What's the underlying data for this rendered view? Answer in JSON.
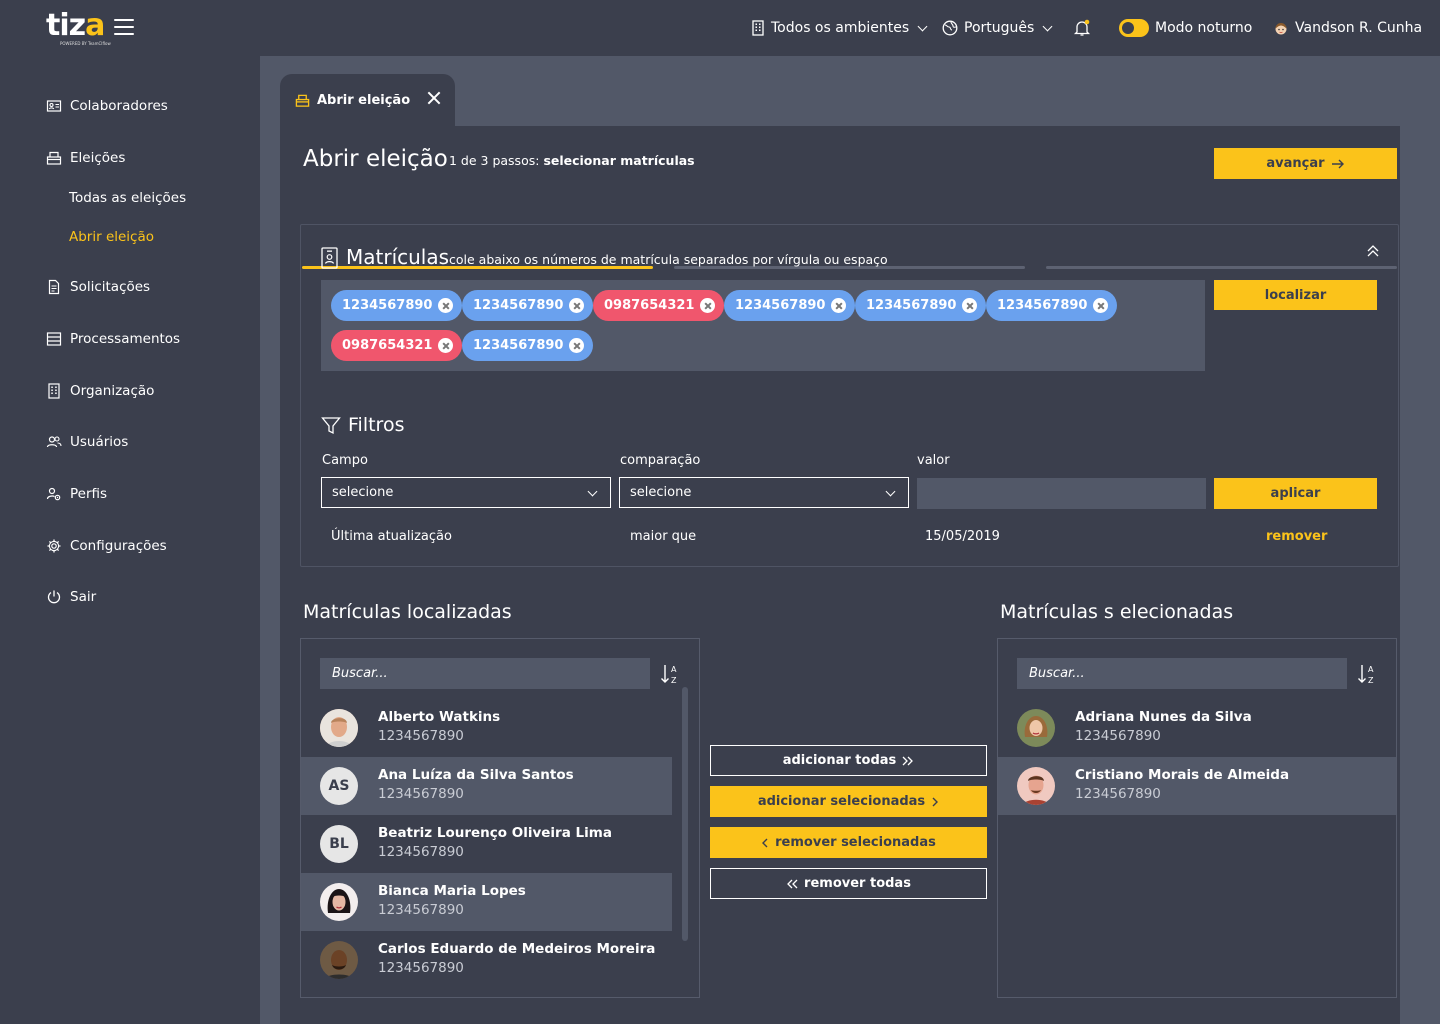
{
  "app": {
    "logo_text": "tiz",
    "logo_accent": "a",
    "logo_sub": "POWERED BY TeamCIflow"
  },
  "topbar": {
    "environments": "Todos os ambientes",
    "language": "Português",
    "night_mode": "Modo noturno",
    "user": "Vandson R. Cunha"
  },
  "sidebar": {
    "items": [
      {
        "label": "Colaboradores",
        "icon": "id-card-icon"
      },
      {
        "label": "Eleições",
        "icon": "ballot-box-icon"
      },
      {
        "label": "Todas as eleições"
      },
      {
        "label": "Abrir eleição"
      },
      {
        "label": "Solicitações",
        "icon": "document-icon"
      },
      {
        "label": "Processamentos",
        "icon": "list-icon"
      },
      {
        "label": "Organização",
        "icon": "building-icon"
      },
      {
        "label": "Usuários",
        "icon": "users-icon"
      },
      {
        "label": "Perfis",
        "icon": "user-gear-icon"
      },
      {
        "label": "Configurações",
        "icon": "gear-icon"
      },
      {
        "label": "Sair",
        "icon": "power-icon"
      }
    ]
  },
  "tab": {
    "label": "Abrir eleição"
  },
  "page": {
    "title": "Abrir eleição",
    "step_prefix": "1 de 3 passos:",
    "step_name": "selecionar matrículas",
    "advance": "avançar",
    "progress": [
      1,
      0,
      0
    ]
  },
  "matriculas": {
    "title": "Matrículas",
    "hint": "cole abaixo os números de matrícula separados por vírgula ou espaço",
    "locate": "localizar",
    "chips": [
      {
        "value": "1234567890",
        "status": "valid"
      },
      {
        "value": "1234567890",
        "status": "valid"
      },
      {
        "value": "0987654321",
        "status": "invalid"
      },
      {
        "value": "1234567890",
        "status": "valid"
      },
      {
        "value": "1234567890",
        "status": "valid"
      },
      {
        "value": "1234567890",
        "status": "valid"
      },
      {
        "value": "0987654321",
        "status": "invalid"
      },
      {
        "value": "1234567890",
        "status": "valid"
      }
    ]
  },
  "filters": {
    "title": "Filtros",
    "field_label": "Campo",
    "comparison_label": "comparação",
    "value_label": "valor",
    "field_value": "selecione",
    "comparison_value": "selecione",
    "value": "",
    "apply": "aplicar",
    "active": {
      "field": "Última atualização",
      "comparison": "maior que",
      "value": "15/05/2019",
      "remove": "remover"
    }
  },
  "found": {
    "title": "Matrículas localizadas",
    "search_placeholder": "Buscar...",
    "rows": [
      {
        "name": "Alberto Watkins",
        "id": "1234567890",
        "avatar": "photo"
      },
      {
        "name": "Ana Luíza da Silva Santos",
        "id": "1234567890",
        "avatar": "AS"
      },
      {
        "name": "Beatriz Lourenço Oliveira Lima",
        "id": "1234567890",
        "avatar": "BL"
      },
      {
        "name": "Bianca Maria Lopes",
        "id": "1234567890",
        "avatar": "photo"
      },
      {
        "name": "Carlos Eduardo de Medeiros Moreira",
        "id": "1234567890",
        "avatar": "photo"
      }
    ]
  },
  "actions": {
    "add_all": "adicionar todas",
    "add_selected": "adicionar selecionadas",
    "remove_selected": "remover selecionadas",
    "remove_all": "remover todas"
  },
  "selected": {
    "title": "Matrículas s elecionadas",
    "search_placeholder": "Buscar...",
    "rows": [
      {
        "name": "Adriana Nunes da Silva",
        "id": "1234567890",
        "avatar": "photo"
      },
      {
        "name": "Cristiano Morais de Almeida",
        "id": "1234567890",
        "avatar": "photo"
      }
    ]
  },
  "colors": {
    "accent": "#fbc31a",
    "bg": "#3b3f4d",
    "panel": "#525868",
    "chip_valid": "#6aa1ee",
    "chip_invalid": "#f0566d"
  }
}
